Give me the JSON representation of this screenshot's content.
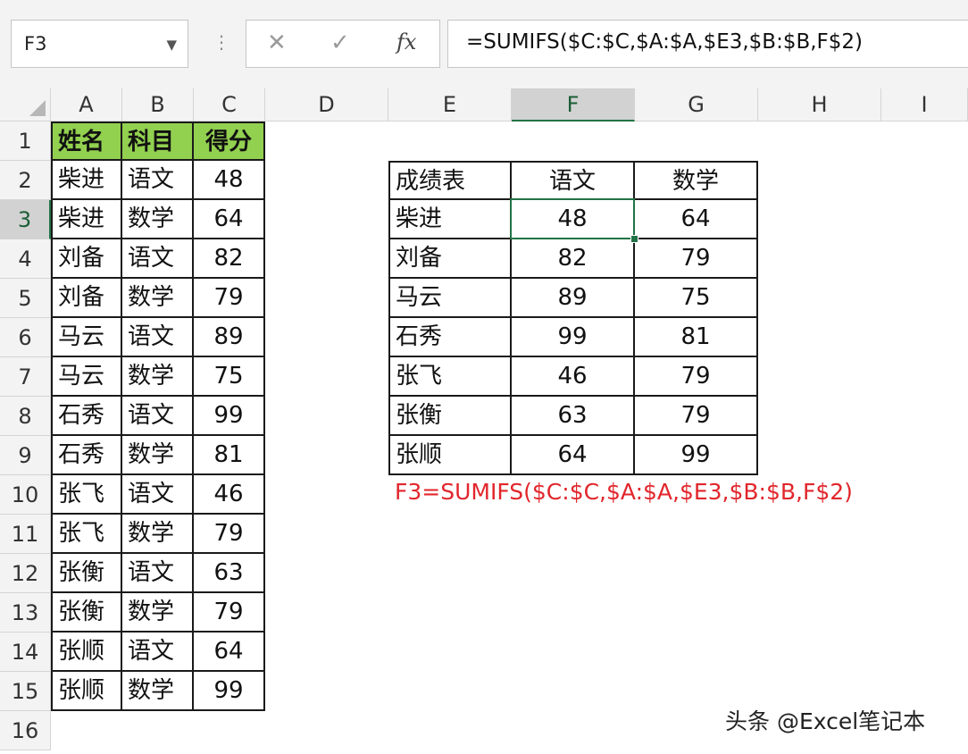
{
  "formula_bar": {
    "name_box": "F3",
    "name_box_arrow": "▼",
    "separator": "⋮",
    "cancel_icon": "✕",
    "enter_icon": "✓",
    "fx_label": "fx",
    "formula": "=SUMIFS($C:$C,$A:$A,$E3,$B:$B,F$2)"
  },
  "columns": [
    "A",
    "B",
    "C",
    "D",
    "E",
    "F",
    "G",
    "H",
    "I"
  ],
  "selected_column": "F",
  "rows": [
    "1",
    "2",
    "3",
    "4",
    "5",
    "6",
    "7",
    "8",
    "9",
    "10",
    "11",
    "12",
    "13",
    "14",
    "15",
    "16"
  ],
  "selected_row": "3",
  "source_table": {
    "headers": [
      "姓名",
      "科目",
      "得分"
    ],
    "header_color": "#92d050",
    "rows": [
      [
        "柴进",
        "语文",
        "48"
      ],
      [
        "柴进",
        "数学",
        "64"
      ],
      [
        "刘备",
        "语文",
        "82"
      ],
      [
        "刘备",
        "数学",
        "79"
      ],
      [
        "马云",
        "语文",
        "89"
      ],
      [
        "马云",
        "数学",
        "75"
      ],
      [
        "石秀",
        "语文",
        "99"
      ],
      [
        "石秀",
        "数学",
        "81"
      ],
      [
        "张飞",
        "语文",
        "46"
      ],
      [
        "张飞",
        "数学",
        "79"
      ],
      [
        "张衡",
        "语文",
        "63"
      ],
      [
        "张衡",
        "数学",
        "79"
      ],
      [
        "张顺",
        "语文",
        "64"
      ],
      [
        "张顺",
        "数学",
        "99"
      ]
    ]
  },
  "summary_table": {
    "headers": [
      "成绩表",
      "语文",
      "数学"
    ],
    "rows": [
      [
        "柴进",
        "48",
        "64"
      ],
      [
        "刘备",
        "82",
        "79"
      ],
      [
        "马云",
        "89",
        "75"
      ],
      [
        "石秀",
        "99",
        "81"
      ],
      [
        "张飞",
        "46",
        "79"
      ],
      [
        "张衡",
        "63",
        "79"
      ],
      [
        "张顺",
        "64",
        "99"
      ]
    ]
  },
  "annotation": {
    "text": "F3=SUMIFS($C:$C,$A:$A,$E3,$B:$B,F$2)",
    "color": "#e1262c"
  },
  "watermark": "头条 @Excel笔记本",
  "accent_color": "#217346"
}
